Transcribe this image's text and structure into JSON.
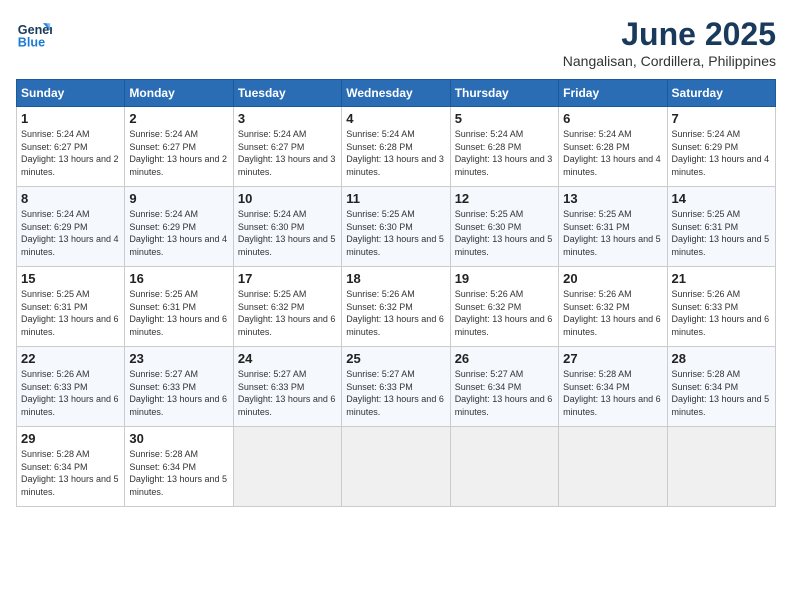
{
  "header": {
    "logo_line1": "General",
    "logo_line2": "Blue",
    "main_title": "June 2025",
    "subtitle": "Nangalisan, Cordillera, Philippines"
  },
  "calendar": {
    "days_of_week": [
      "Sunday",
      "Monday",
      "Tuesday",
      "Wednesday",
      "Thursday",
      "Friday",
      "Saturday"
    ],
    "weeks": [
      [
        null,
        {
          "day": "2",
          "sunrise": "Sunrise: 5:24 AM",
          "sunset": "Sunset: 6:27 PM",
          "daylight": "Daylight: 13 hours and 2 minutes."
        },
        {
          "day": "3",
          "sunrise": "Sunrise: 5:24 AM",
          "sunset": "Sunset: 6:27 PM",
          "daylight": "Daylight: 13 hours and 3 minutes."
        },
        {
          "day": "4",
          "sunrise": "Sunrise: 5:24 AM",
          "sunset": "Sunset: 6:28 PM",
          "daylight": "Daylight: 13 hours and 3 minutes."
        },
        {
          "day": "5",
          "sunrise": "Sunrise: 5:24 AM",
          "sunset": "Sunset: 6:28 PM",
          "daylight": "Daylight: 13 hours and 3 minutes."
        },
        {
          "day": "6",
          "sunrise": "Sunrise: 5:24 AM",
          "sunset": "Sunset: 6:28 PM",
          "daylight": "Daylight: 13 hours and 4 minutes."
        },
        {
          "day": "7",
          "sunrise": "Sunrise: 5:24 AM",
          "sunset": "Sunset: 6:29 PM",
          "daylight": "Daylight: 13 hours and 4 minutes."
        }
      ],
      [
        {
          "day": "1",
          "sunrise": "Sunrise: 5:24 AM",
          "sunset": "Sunset: 6:27 PM",
          "daylight": "Daylight: 13 hours and 2 minutes."
        },
        {
          "day": "9",
          "sunrise": "Sunrise: 5:24 AM",
          "sunset": "Sunset: 6:29 PM",
          "daylight": "Daylight: 13 hours and 4 minutes."
        },
        {
          "day": "10",
          "sunrise": "Sunrise: 5:24 AM",
          "sunset": "Sunset: 6:30 PM",
          "daylight": "Daylight: 13 hours and 5 minutes."
        },
        {
          "day": "11",
          "sunrise": "Sunrise: 5:25 AM",
          "sunset": "Sunset: 6:30 PM",
          "daylight": "Daylight: 13 hours and 5 minutes."
        },
        {
          "day": "12",
          "sunrise": "Sunrise: 5:25 AM",
          "sunset": "Sunset: 6:30 PM",
          "daylight": "Daylight: 13 hours and 5 minutes."
        },
        {
          "day": "13",
          "sunrise": "Sunrise: 5:25 AM",
          "sunset": "Sunset: 6:31 PM",
          "daylight": "Daylight: 13 hours and 5 minutes."
        },
        {
          "day": "14",
          "sunrise": "Sunrise: 5:25 AM",
          "sunset": "Sunset: 6:31 PM",
          "daylight": "Daylight: 13 hours and 5 minutes."
        }
      ],
      [
        {
          "day": "8",
          "sunrise": "Sunrise: 5:24 AM",
          "sunset": "Sunset: 6:29 PM",
          "daylight": "Daylight: 13 hours and 4 minutes."
        },
        {
          "day": "16",
          "sunrise": "Sunrise: 5:25 AM",
          "sunset": "Sunset: 6:31 PM",
          "daylight": "Daylight: 13 hours and 6 minutes."
        },
        {
          "day": "17",
          "sunrise": "Sunrise: 5:25 AM",
          "sunset": "Sunset: 6:32 PM",
          "daylight": "Daylight: 13 hours and 6 minutes."
        },
        {
          "day": "18",
          "sunrise": "Sunrise: 5:26 AM",
          "sunset": "Sunset: 6:32 PM",
          "daylight": "Daylight: 13 hours and 6 minutes."
        },
        {
          "day": "19",
          "sunrise": "Sunrise: 5:26 AM",
          "sunset": "Sunset: 6:32 PM",
          "daylight": "Daylight: 13 hours and 6 minutes."
        },
        {
          "day": "20",
          "sunrise": "Sunrise: 5:26 AM",
          "sunset": "Sunset: 6:32 PM",
          "daylight": "Daylight: 13 hours and 6 minutes."
        },
        {
          "day": "21",
          "sunrise": "Sunrise: 5:26 AM",
          "sunset": "Sunset: 6:33 PM",
          "daylight": "Daylight: 13 hours and 6 minutes."
        }
      ],
      [
        {
          "day": "15",
          "sunrise": "Sunrise: 5:25 AM",
          "sunset": "Sunset: 6:31 PM",
          "daylight": "Daylight: 13 hours and 6 minutes."
        },
        {
          "day": "23",
          "sunrise": "Sunrise: 5:27 AM",
          "sunset": "Sunset: 6:33 PM",
          "daylight": "Daylight: 13 hours and 6 minutes."
        },
        {
          "day": "24",
          "sunrise": "Sunrise: 5:27 AM",
          "sunset": "Sunset: 6:33 PM",
          "daylight": "Daylight: 13 hours and 6 minutes."
        },
        {
          "day": "25",
          "sunrise": "Sunrise: 5:27 AM",
          "sunset": "Sunset: 6:33 PM",
          "daylight": "Daylight: 13 hours and 6 minutes."
        },
        {
          "day": "26",
          "sunrise": "Sunrise: 5:27 AM",
          "sunset": "Sunset: 6:34 PM",
          "daylight": "Daylight: 13 hours and 6 minutes."
        },
        {
          "day": "27",
          "sunrise": "Sunrise: 5:28 AM",
          "sunset": "Sunset: 6:34 PM",
          "daylight": "Daylight: 13 hours and 6 minutes."
        },
        {
          "day": "28",
          "sunrise": "Sunrise: 5:28 AM",
          "sunset": "Sunset: 6:34 PM",
          "daylight": "Daylight: 13 hours and 5 minutes."
        }
      ],
      [
        {
          "day": "22",
          "sunrise": "Sunrise: 5:26 AM",
          "sunset": "Sunset: 6:33 PM",
          "daylight": "Daylight: 13 hours and 6 minutes."
        },
        {
          "day": "30",
          "sunrise": "Sunrise: 5:28 AM",
          "sunset": "Sunset: 6:34 PM",
          "daylight": "Daylight: 13 hours and 5 minutes."
        },
        null,
        null,
        null,
        null,
        null
      ],
      [
        {
          "day": "29",
          "sunrise": "Sunrise: 5:28 AM",
          "sunset": "Sunset: 6:34 PM",
          "daylight": "Daylight: 13 hours and 5 minutes."
        },
        null,
        null,
        null,
        null,
        null,
        null
      ]
    ]
  }
}
